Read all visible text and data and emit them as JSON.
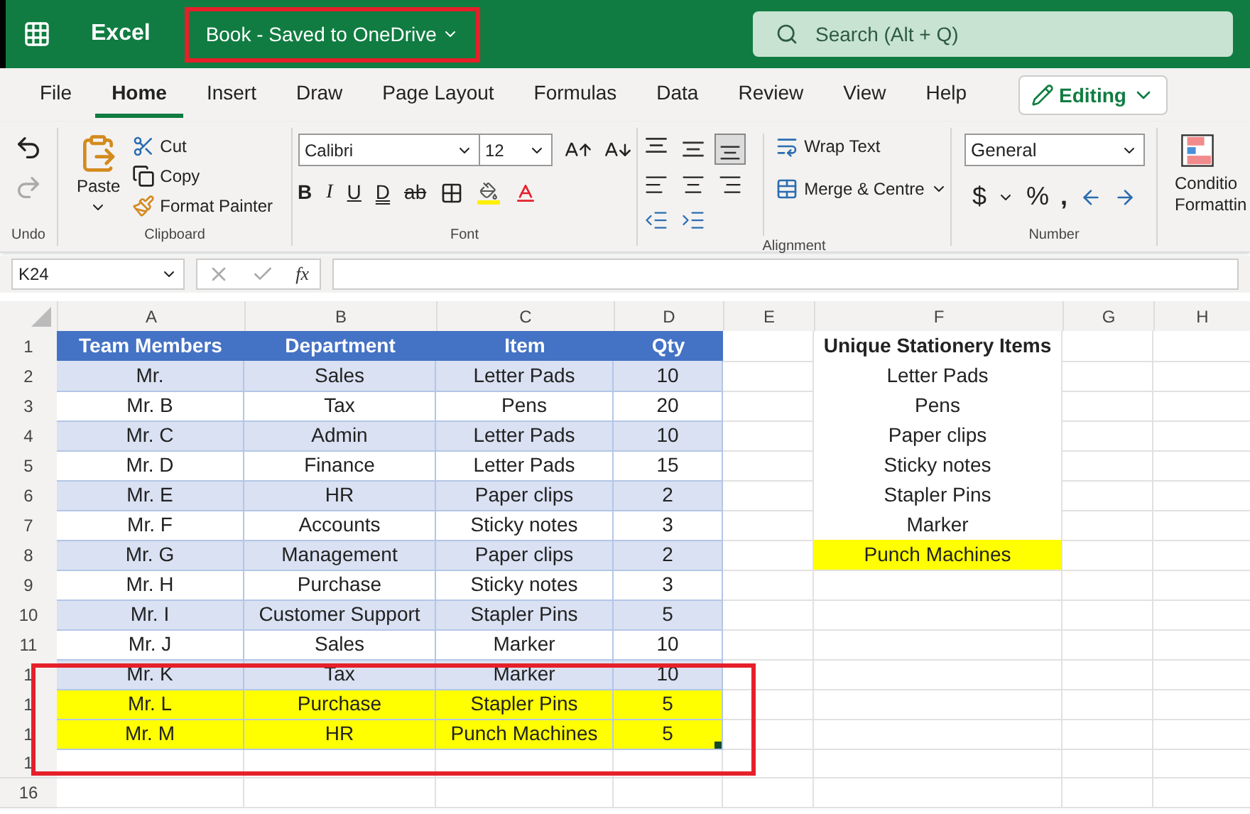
{
  "top_bar": {
    "app_name": "Excel",
    "document_title": "Book - Saved to OneDrive",
    "search": {
      "placeholder": "Search (Alt + Q)"
    }
  },
  "tabs": [
    {
      "label": "File",
      "selected": false
    },
    {
      "label": "Home",
      "selected": true
    },
    {
      "label": "Insert",
      "selected": false
    },
    {
      "label": "Draw",
      "selected": false
    },
    {
      "label": "Page Layout",
      "selected": false
    },
    {
      "label": "Formulas",
      "selected": false
    },
    {
      "label": "Data",
      "selected": false
    },
    {
      "label": "Review",
      "selected": false
    },
    {
      "label": "View",
      "selected": false
    },
    {
      "label": "Help",
      "selected": false
    }
  ],
  "mode_button": "Editing",
  "ribbon": {
    "undo": {
      "label": "Undo"
    },
    "clipboard": {
      "label": "Clipboard",
      "paste": "Paste",
      "cut": "Cut",
      "copy": "Copy",
      "format_painter": "Format Painter"
    },
    "font": {
      "label": "Font",
      "name": "Calibri",
      "size": "12",
      "bold": "B",
      "italic": "I",
      "underline": "U",
      "double_underline": "D",
      "strikethrough": "ab"
    },
    "alignment": {
      "label": "Alignment",
      "vertical": [
        {
          "kind": "top",
          "selected": false
        },
        {
          "kind": "middle",
          "selected": false
        },
        {
          "kind": "bottom",
          "selected": true
        }
      ],
      "wrap_text": "Wrap Text",
      "merge": "Merge & Centre"
    },
    "number": {
      "label": "Number",
      "format": "General",
      "currency": "$",
      "percent": "%",
      "comma": ","
    },
    "conditional": {
      "line_1": "Conditio",
      "line_2": "Formattin"
    }
  },
  "formula_bar": {
    "name_box": "K24",
    "fx": "fx"
  },
  "sheet": {
    "columns": [
      "A",
      "B",
      "C",
      "D",
      "E",
      "F",
      "G",
      "H"
    ],
    "rows": [
      {
        "number": "1",
        "kind": "header",
        "cells": [
          "Team Members",
          "Department",
          "Item",
          "Qty"
        ],
        "highlighted": false,
        "unique": "Unique Stationery Items",
        "unique_highlighted": false
      },
      {
        "number": "2",
        "kind": "data",
        "cells": [
          "Mr.",
          "Sales",
          "Letter Pads",
          "10"
        ],
        "highlighted": false,
        "unique": "Letter Pads",
        "unique_highlighted": false
      },
      {
        "number": "3",
        "kind": "data",
        "cells": [
          "Mr. B",
          "Tax",
          "Pens",
          "20"
        ],
        "highlighted": false,
        "unique": "Pens",
        "unique_highlighted": false
      },
      {
        "number": "4",
        "kind": "data",
        "cells": [
          "Mr. C",
          "Admin",
          "Letter Pads",
          "10"
        ],
        "highlighted": false,
        "unique": "Paper clips",
        "unique_highlighted": false
      },
      {
        "number": "5",
        "kind": "data",
        "cells": [
          "Mr. D",
          "Finance",
          "Letter Pads",
          "15"
        ],
        "highlighted": false,
        "unique": "Sticky notes",
        "unique_highlighted": false
      },
      {
        "number": "6",
        "kind": "data",
        "cells": [
          "Mr. E",
          "HR",
          "Paper clips",
          "2"
        ],
        "highlighted": false,
        "unique": "Stapler Pins",
        "unique_highlighted": false
      },
      {
        "number": "7",
        "kind": "data",
        "cells": [
          "Mr. F",
          "Accounts",
          "Sticky notes",
          "3"
        ],
        "highlighted": false,
        "unique": "Marker",
        "unique_highlighted": false
      },
      {
        "number": "8",
        "kind": "data",
        "cells": [
          "Mr. G",
          "Management",
          "Paper clips",
          "2"
        ],
        "highlighted": false,
        "unique": "Punch Machines",
        "unique_highlighted": true
      },
      {
        "number": "9",
        "kind": "data",
        "cells": [
          "Mr. H",
          "Purchase",
          "Sticky notes",
          "3"
        ],
        "highlighted": false
      },
      {
        "number": "10",
        "kind": "data",
        "cells": [
          "Mr. I",
          "Customer Support",
          "Stapler Pins",
          "5"
        ],
        "highlighted": false
      },
      {
        "number": "11",
        "kind": "data",
        "cells": [
          "Mr. J",
          "Sales",
          "Marker",
          "10"
        ],
        "highlighted": false
      },
      {
        "number": "1",
        "kind": "data",
        "cells": [
          "Mr. K",
          "Tax",
          "Marker",
          "10"
        ],
        "highlighted": false
      },
      {
        "number": "1",
        "kind": "data",
        "cells": [
          "Mr. L",
          "Purchase",
          "Stapler Pins",
          "5"
        ],
        "highlighted": true
      },
      {
        "number": "1",
        "kind": "data",
        "cells": [
          "Mr. M",
          "HR",
          "Punch Machines",
          "5"
        ],
        "highlighted": true
      },
      {
        "number": "1",
        "kind": "empty"
      },
      {
        "number": "16",
        "kind": "empty"
      }
    ]
  }
}
